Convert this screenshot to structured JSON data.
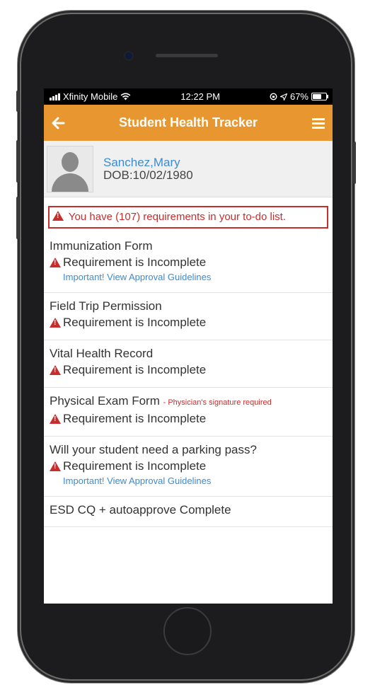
{
  "status_bar": {
    "carrier": "Xfinity Mobile",
    "time": "12:22 PM",
    "battery": "67%",
    "battery_level": 0.67
  },
  "app_bar": {
    "title": "Student Health Tracker",
    "back_icon": "arrow-left-icon",
    "menu_icon": "hamburger-menu-icon"
  },
  "profile": {
    "name": "Sanchez,Mary",
    "dob": "DOB:10/02/1980"
  },
  "alert": {
    "text": "You have (107) requirements in your to-do list."
  },
  "requirements": [
    {
      "title": "Immunization Form",
      "note": "",
      "status": "Requirement is Incomplete",
      "link": "Important! View Approval Guidelines"
    },
    {
      "title": "Field Trip Permission",
      "note": "",
      "status": "Requirement is Incomplete",
      "link": ""
    },
    {
      "title": "Vital Health Record",
      "note": "",
      "status": "Requirement is Incomplete",
      "link": ""
    },
    {
      "title": "Physical Exam Form",
      "note": "- Physician's signature required",
      "status": "Requirement is Incomplete",
      "link": ""
    },
    {
      "title": "Will your student need a parking pass?",
      "note": "",
      "status": "Requirement is Incomplete",
      "link": "Important! View Approval Guidelines"
    },
    {
      "title": "ESD CQ + autoapprove Complete",
      "note": "",
      "status": "",
      "link": ""
    }
  ],
  "colors": {
    "accent": "#e8962f",
    "alert_red": "#c62e2e",
    "link_blue": "#3d8bd0"
  }
}
